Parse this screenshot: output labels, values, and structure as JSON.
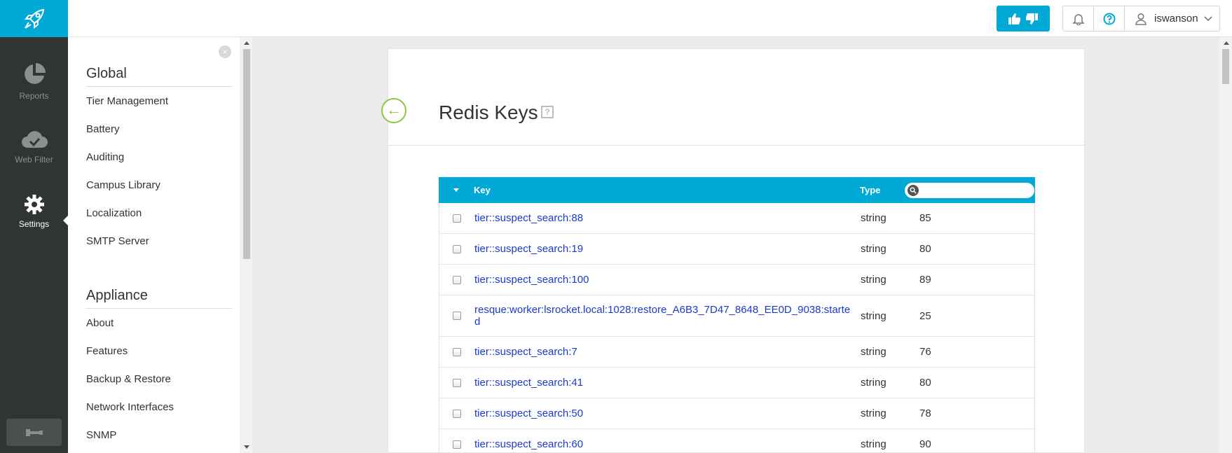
{
  "rail": {
    "items": [
      {
        "label": "Reports",
        "icon": "pie-chart-icon"
      },
      {
        "label": "Web Filter",
        "icon": "cloud-check-icon"
      },
      {
        "label": "Settings",
        "icon": "gear-icon",
        "active": true
      }
    ]
  },
  "topbar": {
    "username": "iswanson"
  },
  "sidebar": {
    "sections": [
      {
        "title": "Global",
        "items": [
          "Tier Management",
          "Battery",
          "Auditing",
          "Campus Library",
          "Localization",
          "SMTP Server"
        ]
      },
      {
        "title": "Appliance",
        "items": [
          "About",
          "Features",
          "Backup & Restore",
          "Network Interfaces",
          "SNMP"
        ]
      }
    ]
  },
  "page": {
    "title": "Redis Keys",
    "help_glyph": "?",
    "back_glyph": "←"
  },
  "table": {
    "columns": {
      "key": "Key",
      "type": "Type"
    },
    "search_placeholder": "",
    "rows": [
      {
        "key": "tier::suspect_search:88",
        "type": "string",
        "value": "85"
      },
      {
        "key": "tier::suspect_search:19",
        "type": "string",
        "value": "80"
      },
      {
        "key": "tier::suspect_search:100",
        "type": "string",
        "value": "89"
      },
      {
        "key": "resque:worker:lsrocket.local:1028:restore_A6B3_7D47_8648_EE0D_9038:started",
        "type": "string",
        "value": "25"
      },
      {
        "key": "tier::suspect_search:7",
        "type": "string",
        "value": "76"
      },
      {
        "key": "tier::suspect_search:41",
        "type": "string",
        "value": "80"
      },
      {
        "key": "tier::suspect_search:50",
        "type": "string",
        "value": "78"
      },
      {
        "key": "tier::suspect_search:60",
        "type": "string",
        "value": "90"
      }
    ]
  },
  "colors": {
    "accent": "#00a9d6",
    "rail_bg": "#303434",
    "link": "#1a3acc",
    "back_green": "#8cc63f"
  }
}
